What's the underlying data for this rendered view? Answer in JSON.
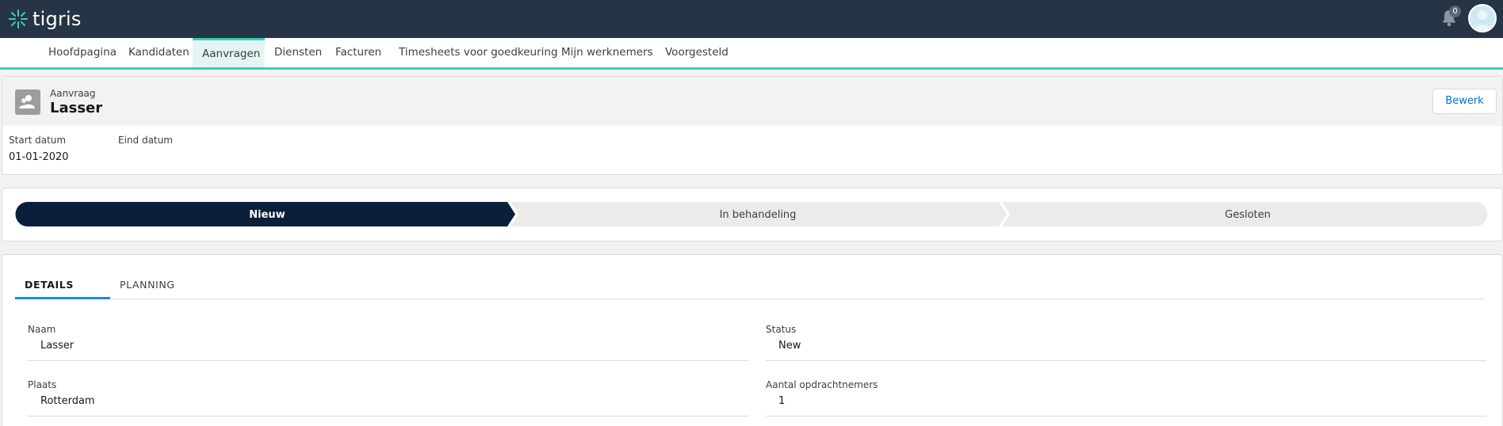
{
  "app": {
    "name": "tigris",
    "notification_count": "0"
  },
  "nav": {
    "items": [
      {
        "label": "Hoofdpagina"
      },
      {
        "label": "Kandidaten"
      },
      {
        "label": "Aanvragen"
      },
      {
        "label": "Diensten"
      },
      {
        "label": "Facturen"
      },
      {
        "label": "Timesheets voor goedkeuring"
      },
      {
        "label": "Mijn werknemers"
      },
      {
        "label": "Voorgesteld"
      }
    ],
    "active": "Aanvragen"
  },
  "record": {
    "type": "Aanvraag",
    "title": "Lasser",
    "edit_label": "Bewerk",
    "fields": {
      "start_label": "Start datum",
      "start_value": "01-01-2020",
      "end_label": "Eind datum",
      "end_value": ""
    }
  },
  "path": {
    "stages": [
      "Nieuw",
      "In behandeling",
      "Gesloten"
    ],
    "current": "Nieuw"
  },
  "tabs": [
    {
      "label": "DETAILS"
    },
    {
      "label": "PLANNING"
    }
  ],
  "details": {
    "naam_label": "Naam",
    "naam_value": "Lasser",
    "plaats_label": "Plaats",
    "plaats_value": "Rotterdam",
    "status_label": "Status",
    "status_value": "New",
    "aantal_label": "Aantal opdrachtnemers",
    "aantal_value": "1"
  },
  "colors": {
    "topbar": "#263545",
    "accent": "#3ccdb4",
    "path_current": "#0b1f3a",
    "path_inactive": "#ecebea",
    "link": "#0070d2"
  }
}
